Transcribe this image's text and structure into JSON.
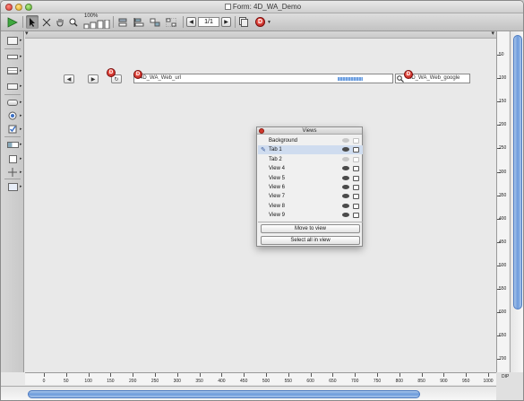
{
  "window": {
    "title": "Form: 4D_WA_Demo"
  },
  "toolbar": {
    "zoom_label": "100%",
    "page_value": "1/1",
    "prev_page": "◀",
    "next_page": "▶",
    "run_icon": "run-form-icon"
  },
  "form": {
    "back_label": "◀",
    "forward_label": "▶",
    "reload_label": "↻",
    "web_url_field": "4D_WA_Web_url",
    "google_field": "4D_WA_Web_google"
  },
  "views_palette": {
    "title": "Views",
    "items": [
      {
        "label": "Background",
        "visible": false,
        "locked": false
      },
      {
        "label": "Tab 1",
        "visible": true,
        "locked": true,
        "selected": true
      },
      {
        "label": "Tab 2",
        "visible": false,
        "locked": false
      },
      {
        "label": "View 4",
        "visible": true,
        "locked": true
      },
      {
        "label": "View 5",
        "visible": true,
        "locked": true
      },
      {
        "label": "View 6",
        "visible": true,
        "locked": true
      },
      {
        "label": "View 7",
        "visible": true,
        "locked": true
      },
      {
        "label": "View 8",
        "visible": true,
        "locked": true
      },
      {
        "label": "View 9",
        "visible": true,
        "locked": true
      }
    ],
    "move_button": "Move to view",
    "select_all_button": "Select all in view"
  },
  "rulers": {
    "horizontal": [
      "0",
      "50",
      "100",
      "150",
      "200",
      "250",
      "300",
      "350",
      "400",
      "450",
      "500",
      "550",
      "600",
      "650",
      "700",
      "750",
      "800",
      "850",
      "900",
      "950",
      "1000"
    ],
    "vertical": [
      "50",
      "100",
      "150",
      "200",
      "250",
      "300",
      "350",
      "400",
      "450",
      "500",
      "550",
      "600",
      "650",
      "700"
    ],
    "unit_label": "DIP"
  },
  "colors": {
    "selection": "#cfdcef",
    "scroll_thumb": "#6c9bdc",
    "close_red": "#d0382c"
  }
}
